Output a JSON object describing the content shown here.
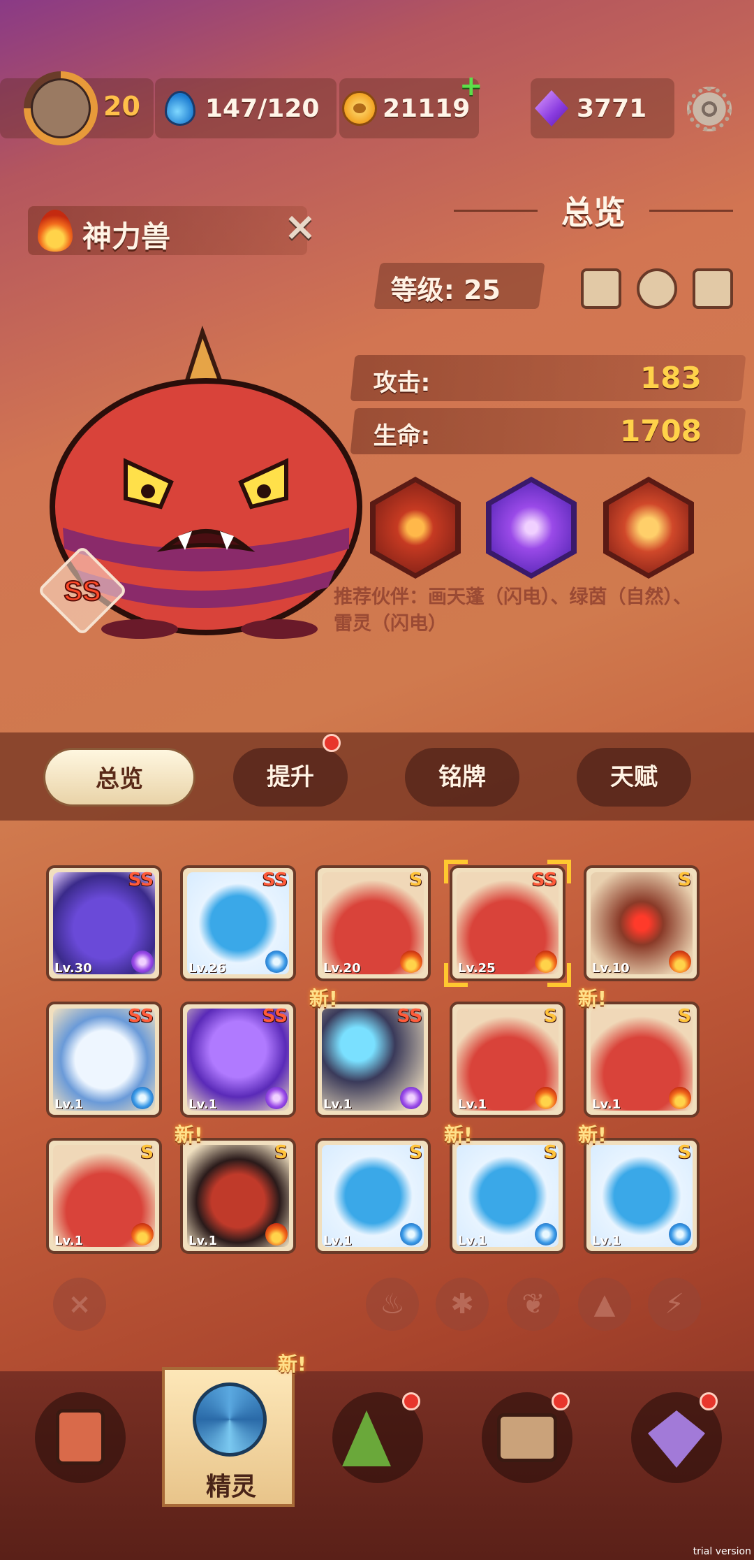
{
  "top_bar": {
    "player_level": "20",
    "energy": "147/120",
    "coins": "21119",
    "gems": "3771"
  },
  "monster": {
    "name": "神力兽",
    "rank": "SS",
    "element": "fire"
  },
  "overview": {
    "title": "总览",
    "level_label": "等级: 25",
    "stats": [
      {
        "label": "攻击:",
        "value": "183"
      },
      {
        "label": "生命:",
        "value": "1708"
      }
    ],
    "recommend": "推荐伙伴：画天蓬（闪电）、绿茵（自然）、雷灵（闪电）"
  },
  "tabs": [
    {
      "label": "总览",
      "active": true,
      "dot": false
    },
    {
      "label": "提升",
      "active": false,
      "dot": true
    },
    {
      "label": "铭牌",
      "active": false,
      "dot": false
    },
    {
      "label": "天赋",
      "active": false,
      "dot": false
    }
  ],
  "cards": [
    {
      "rank": "SS",
      "lv": "Lv.30",
      "element": "lightning",
      "art": "purple-cat",
      "new": ""
    },
    {
      "rank": "SS",
      "lv": "Lv.26",
      "element": "ice",
      "art": "blue-fish",
      "new": ""
    },
    {
      "rank": "S",
      "lv": "Lv.20",
      "element": "fire",
      "art": "red-horn",
      "new": ""
    },
    {
      "rank": "SS",
      "lv": "Lv.25",
      "element": "fire",
      "art": "red-horn",
      "new": "",
      "selected": true
    },
    {
      "rank": "S",
      "lv": "Lv.10",
      "element": "fire",
      "art": "boiler",
      "new": ""
    },
    {
      "rank": "SS",
      "lv": "Lv.1",
      "element": "ice",
      "art": "white-tiger",
      "new": ""
    },
    {
      "rank": "SS",
      "lv": "Lv.1",
      "element": "lightning",
      "art": "jellyfish",
      "new": ""
    },
    {
      "rank": "SS",
      "lv": "Lv.1",
      "element": "lightning",
      "art": "cannon",
      "new": "新!"
    },
    {
      "rank": "S",
      "lv": "Lv.1",
      "element": "fire",
      "art": "red-horn",
      "new": ""
    },
    {
      "rank": "S",
      "lv": "Lv.1",
      "element": "fire",
      "art": "red-horn",
      "new": "新!"
    },
    {
      "rank": "S",
      "lv": "Lv.1",
      "element": "fire",
      "art": "red-horn",
      "new": ""
    },
    {
      "rank": "S",
      "lv": "Lv.1",
      "element": "fire",
      "art": "ox-demon",
      "new": "新!"
    },
    {
      "rank": "S",
      "lv": "Lv.1",
      "element": "ice",
      "art": "blue-fish",
      "new": ""
    },
    {
      "rank": "S",
      "lv": "Lv.1",
      "element": "ice",
      "art": "blue-fish",
      "new": "新!"
    },
    {
      "rank": "S",
      "lv": "Lv.1",
      "element": "ice",
      "art": "blue-fish",
      "new": "新!"
    }
  ],
  "filters": [
    "clear",
    "fire",
    "ice",
    "nature",
    "earth",
    "lightning"
  ],
  "bottom_nav": {
    "active_label": "精灵",
    "active_new": "新!",
    "items": [
      "device",
      "spirit",
      "mountain",
      "chest",
      "map-pin"
    ]
  },
  "watermark": "trial version",
  "colors": {
    "accent_gold": "#ffd24a",
    "rank_ss": "#ff5b3a",
    "rank_s": "#ffc33a",
    "badge_red": "#e8362c"
  }
}
